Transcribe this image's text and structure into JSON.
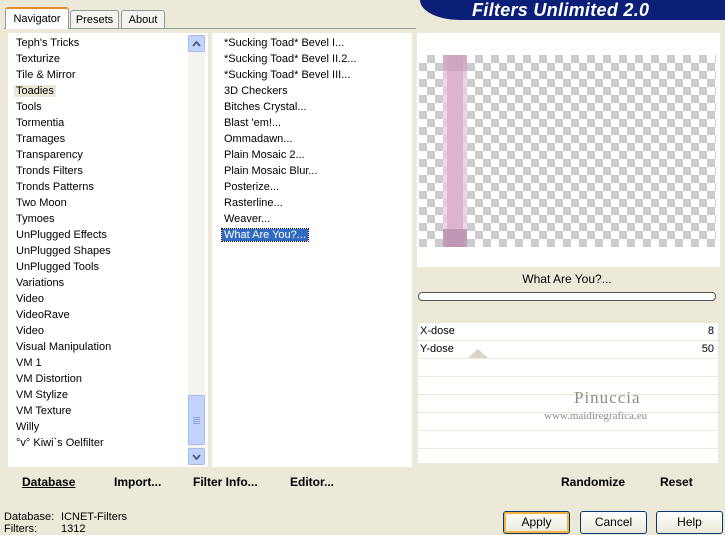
{
  "tabs": [
    {
      "label": "Navigator",
      "active": true
    },
    {
      "label": "Presets",
      "active": false
    },
    {
      "label": "About",
      "active": false
    }
  ],
  "banner_title": "Filters Unlimited 2.0",
  "categories": {
    "items": [
      "Teph's Tricks",
      "Texturize",
      "Tile & Mirror",
      "Toadies",
      "Tools",
      "Tormentia",
      "Tramages",
      "Transparency",
      "Tronds Filters",
      "Tronds Patterns",
      "Two Moon",
      "Tymoes",
      "UnPlugged Effects",
      "UnPlugged Shapes",
      "UnPlugged Tools",
      "Variations",
      "Video",
      "VideoRave",
      "Video",
      "Visual Manipulation",
      "VM 1",
      "VM Distortion",
      "VM Stylize",
      "VM Texture",
      "Willy",
      "°v° Kiwi`s Oelfilter"
    ],
    "selected": "Toadies"
  },
  "filters": {
    "items": [
      "*Sucking Toad*  Bevel I...",
      "*Sucking Toad*  Bevel II.2...",
      "*Sucking Toad*  Bevel III...",
      "3D Checkers",
      "Bitches Crystal...",
      "Blast 'em!...",
      "Ommadawn...",
      "Plain Mosaic 2...",
      "Plain Mosaic Blur...",
      "Posterize...",
      "Rasterline...",
      "Weaver...",
      "What Are You?..."
    ],
    "selected": "What Are You?..."
  },
  "filter_name": "What Are You?...",
  "progress": 0,
  "params": [
    {
      "label": "X-dose",
      "value": "8"
    },
    {
      "label": "Y-dose",
      "value": "50"
    }
  ],
  "watermark": {
    "line1": "Pinuccia",
    "line2": "www.maidiregrafica.eu"
  },
  "toolbar": {
    "database": "Database",
    "import": "Import...",
    "filter_info": "Filter Info...",
    "editor": "Editor...",
    "randomize": "Randomize",
    "reset": "Reset"
  },
  "status": {
    "database_label": "Database:",
    "database_value": "ICNET-Filters",
    "filters_label": "Filters:",
    "filters_value": "1312"
  },
  "dialog": {
    "apply": "Apply",
    "cancel": "Cancel",
    "help": "Help"
  },
  "colors": {
    "selection": "#316ac5",
    "banner": "#0c1f78",
    "preview_stripe": "#dcb4d0"
  }
}
